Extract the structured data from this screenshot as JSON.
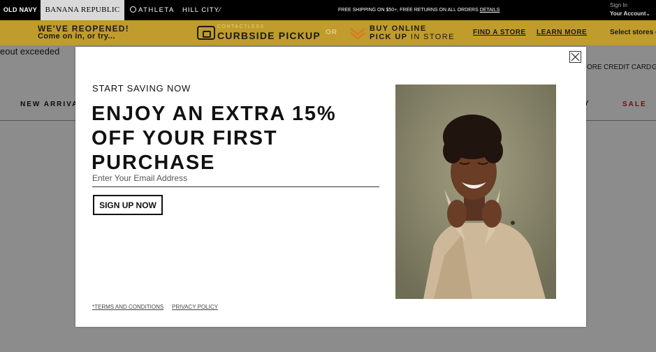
{
  "brands": {
    "old_navy": "OLD NAVY",
    "banana_republic": "BANANA REPUBLIC",
    "athleta": "ATHLETA",
    "hill_city": "HILL CITY"
  },
  "header": {
    "shipping": "FREE SHIPPING ON $50+, FREE RETURNS ON ALL ORDERS",
    "shipping_link": "DETAILS",
    "sign_in": "Sign In",
    "your_account": "Your Account"
  },
  "promo": {
    "reopened_title": "WE'VE REOPENED!",
    "reopened_sub": "Come on in, or try...",
    "contactless": "CONTACTLESS",
    "curbside": "CURBSIDE PICKUP",
    "or": "OR",
    "buy_online": "BUY ONLINE",
    "pick_up": "PICK UP",
    "in_store": "IN STORE",
    "find_store": "FIND A STORE",
    "learn_more": "LEARN MORE",
    "select_stores": "Select stores o"
  },
  "page": {
    "timeout_text": "eout exceeded",
    "nav_ore": "ORE",
    "nav_credit": "CREDIT CARD",
    "nav_g": "G",
    "new_arrivals": "NEW ARRIVALS",
    "nav_y": "Y",
    "sale": "SALE"
  },
  "modal": {
    "kicker": "START SAVING NOW",
    "headline": "ENJOY AN EXTRA 15% OFF YOUR FIRST PURCHASE",
    "email_placeholder": "Enter Your Email Address",
    "signup_label": "SIGN UP NOW",
    "terms": "*TERMS AND CONDITIONS",
    "privacy": "PRIVACY POLICY"
  },
  "colors": {
    "promo_bg": "#bf9c2b",
    "sale_red": "#c81e1e",
    "topbar_bg": "#000000"
  }
}
